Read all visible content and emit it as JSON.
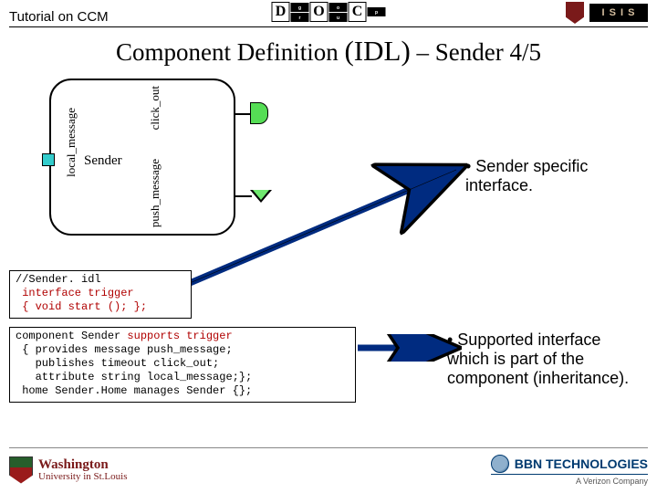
{
  "header": {
    "title": "Tutorial on CCM",
    "logo_doc_letters": [
      "D",
      "O",
      "C"
    ],
    "logo_doc_small": [
      "g",
      "r",
      "o",
      "u",
      "p"
    ],
    "isis_text": "I S I S"
  },
  "slide": {
    "title_pre": "Component Definition ",
    "title_idl": "(IDL)",
    "title_post": " – Sender 4/5"
  },
  "diagram": {
    "component_name": "Sender",
    "port_local": "local_message",
    "port_click": "click_out",
    "port_push": "push_message"
  },
  "bullets": {
    "b1": "• Sender specific interface.",
    "b2": "• Supported interface which is part of the component (inheritance)."
  },
  "code1": {
    "l1": "//Sender. idl",
    "l2": " interface trigger",
    "l3": " { void start (); };"
  },
  "code2": {
    "l1_a": "component Sender ",
    "l1_b": "supports trigger",
    "l2": " { provides message push_message;",
    "l3": "   publishes timeout click_out;",
    "l4": "   attribute string local_message;};",
    "l5": " home Sender.Home manages Sender {};"
  },
  "footer": {
    "wustl_top": "Washington",
    "wustl_bottom": "University in St.Louis",
    "bbn_name": "BBN TECHNOLOGIES",
    "bbn_sub": "A Verizon Company"
  }
}
